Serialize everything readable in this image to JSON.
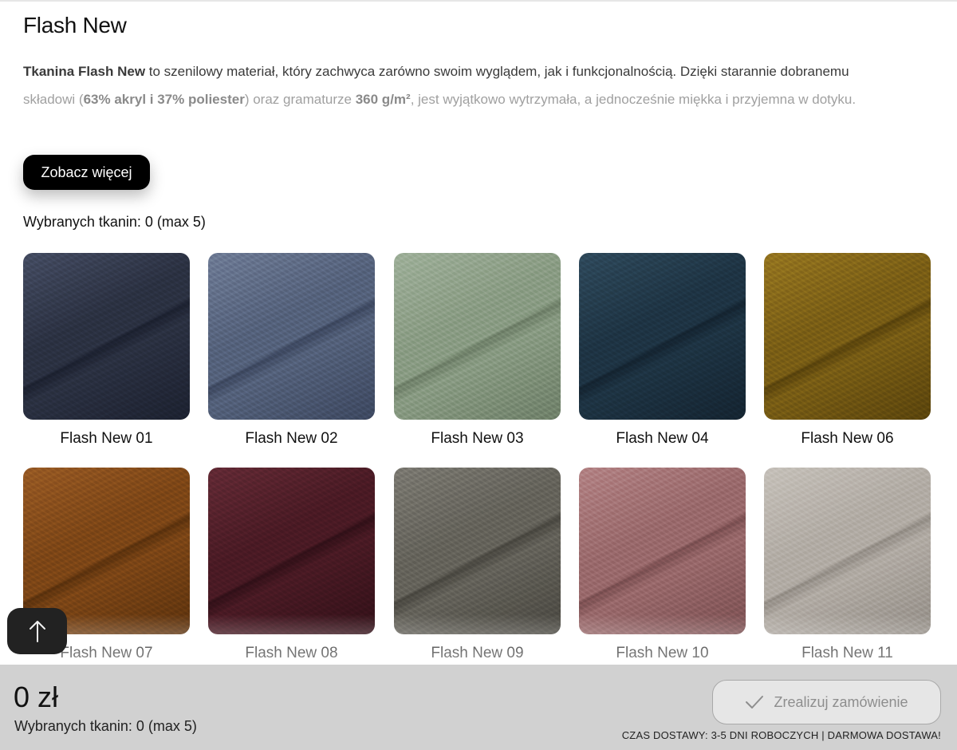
{
  "page": {
    "title": "Flash New",
    "description": {
      "line1": {
        "lead_bold": "Tkanina Flash New",
        "lead_rest": " to szenilowy materiał, który zachwyca zarówno swoim wyglądem, jak i funkcjonalnością. Dzięki starannie dobranemu"
      },
      "line2": {
        "p1": "składowi (",
        "b1": "63% akryl i 37% poliester",
        "p2": ") oraz gramaturze ",
        "b2": "360 g/m²",
        "p3": ", jest wyjątkowo wytrzymała, a jednocześnie miękka i przyjemna w dotyku."
      }
    },
    "more_button": "Zobacz więcej",
    "selected_counter": "Wybranych tkanin: 0 (max 5)"
  },
  "fabrics": [
    {
      "name": "Flash New 01",
      "color": "#2b3142",
      "light": "#454d63",
      "dark": "#1c2130"
    },
    {
      "name": "Flash New 02",
      "color": "#55627c",
      "light": "#6f7c96",
      "dark": "#3d4860"
    },
    {
      "name": "Flash New 03",
      "color": "#8a9c84",
      "light": "#9fb09a",
      "dark": "#6f8069"
    },
    {
      "name": "Flash New 04",
      "color": "#1e3444",
      "light": "#2f4a5c",
      "dark": "#142431"
    },
    {
      "name": "Flash New 06",
      "color": "#7a5e15",
      "light": "#967620",
      "dark": "#5a440c"
    },
    {
      "name": "Flash New 07",
      "color": "#7d4616",
      "light": "#985a24",
      "dark": "#5c320d"
    },
    {
      "name": "Flash New 08",
      "color": "#4a1a24",
      "light": "#632a35",
      "dark": "#321018"
    },
    {
      "name": "Flash New 09",
      "color": "#65635b",
      "light": "#7c7a72",
      "dark": "#4a4841"
    },
    {
      "name": "Flash New 10",
      "color": "#9a6a6c",
      "light": "#b38385",
      "dark": "#7c5052"
    },
    {
      "name": "Flash New 11",
      "color": "#b2aca5",
      "light": "#c6c1ba",
      "dark": "#958f88"
    }
  ],
  "bottom_bar": {
    "price": "0 zł",
    "selected_counter": "Wybranych tkanin: 0 (max 5)",
    "order_button": "Zrealizuj zamówienie",
    "delivery_info": "CZAS DOSTAWY: 3-5 DNI ROBOCZYCH | DARMOWA DOSTAWA!"
  },
  "icons": {
    "scroll_top": "arrow-up-icon",
    "order_check": "checkmark-icon"
  }
}
